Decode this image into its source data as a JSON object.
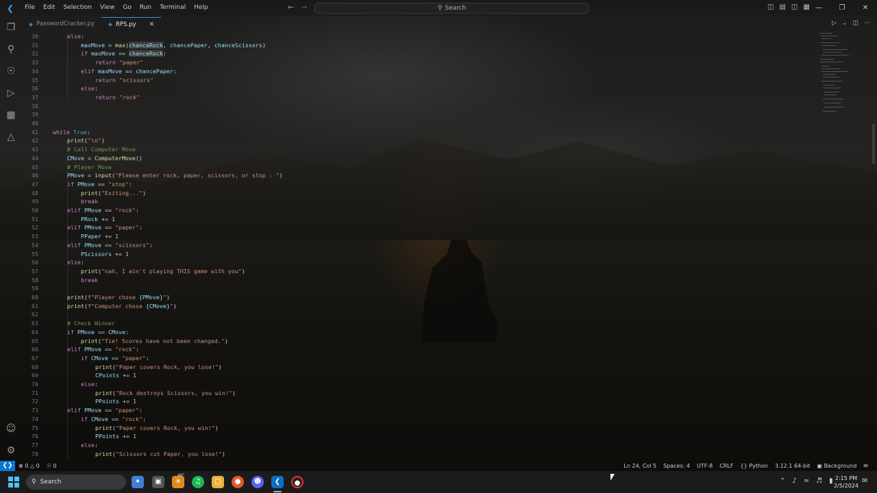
{
  "menu": [
    "File",
    "Edit",
    "Selection",
    "View",
    "Go",
    "Run",
    "Terminal",
    "Help"
  ],
  "search": {
    "label": "Search"
  },
  "tabs": [
    {
      "label": "PasswordCracker.py",
      "active": false
    },
    {
      "label": "RPS.py",
      "active": true
    }
  ],
  "icons": {
    "explorer": "files-icon",
    "search": "search-icon",
    "scm": "source-control-icon",
    "run": "run-debug-icon",
    "extensions": "extensions-icon",
    "testing": "beaker-icon",
    "account": "account-icon",
    "settings": "gear-icon"
  },
  "code": {
    "l30": "30",
    "l31": "31",
    "l32": "32",
    "l33": "33",
    "l34": "34",
    "l35": "35",
    "l36": "36",
    "l37": "37",
    "l38": "38",
    "l39": "39",
    "l40": "40",
    "l41": "41",
    "l42": "42",
    "l43": "43",
    "l44": "44",
    "l45": "45",
    "l46": "46",
    "l47": "47",
    "l48": "48",
    "l49": "49",
    "l50": "50",
    "l51": "51",
    "l52": "52",
    "l53": "53",
    "l54": "54",
    "l55": "55",
    "l56": "56",
    "l57": "57",
    "l58": "58",
    "l59": "59",
    "l60": "60",
    "l61": "61",
    "l62": "62",
    "l63": "63",
    "l64": "64",
    "l65": "65",
    "l66": "66",
    "l67": "67",
    "l68": "68",
    "l69": "69",
    "l70": "70",
    "l71": "71",
    "l72": "72",
    "l73": "73",
    "l74": "74",
    "l75": "75",
    "l76": "76",
    "l77": "77",
    "l78": "78",
    "else": "else",
    "colon": ":",
    "maxMove": "maxMove",
    "eq": " = ",
    "max": "max",
    "chanceRock": "chanceRock",
    "chancePaper": "chancePaper",
    "chanceScissors": "chanceScissors",
    "if": "if",
    "elif": "elif",
    "eqeq": " == ",
    "return": "return",
    "paper": "\"paper\"",
    "scissors": "\"scissors\"",
    "rock": "\"rock\"",
    "while": "while",
    "True": "True",
    "print": "print",
    "newline_str": "\"\\n\"",
    "cm_computer": "# Call Computer Move",
    "CMove": "CMove",
    "ComputerMove": "ComputerMove",
    "cm_player": "# Player Move",
    "PMove": "PMove",
    "input": "input",
    "prompt": "\"Please enter rock, paper, scissors, or stop : \"",
    "stop": "\"stop\"",
    "exiting": "\"Exiting...\"",
    "break": "break",
    "PRock": "PRock",
    "PPaper": "PPaper",
    "PScissors": "PScissors",
    "pluseq": " += ",
    "one": "1",
    "nah": "\"nah, I ain't playing THIS game with you\"",
    "f_player_a": "f\"Player chose ",
    "f_computer_a": "f\"Computer chose ",
    "f_pmove": "{PMove}",
    "f_cmove": "{CMove}",
    "f_end": "\"",
    "cm_winner": "# Check Winner",
    "tie": "\"Tie! Scores have not been changed.\"",
    "paper_covers_lose": "\"Paper covers Rock, you lose!\"",
    "CPoints": "CPoints",
    "rock_destroys_win": "\"Rock destroys Scissors, you win!\"",
    "PPoints": "PPoints",
    "paper_covers_win": "\"Paper covers Rock, you win!\"",
    "scissors_cut_lose": "\"Scissors cut Paper, you lose!\""
  },
  "status": {
    "errors": "0",
    "warnings": "0",
    "ports": "0",
    "position": "Ln 24, Col 5",
    "spaces": "Spaces: 4",
    "encoding": "UTF-8",
    "eol": "CRLF",
    "language": "Python",
    "interpreter": "3.12.1 64-bit",
    "theme": "Background"
  },
  "taskbar": {
    "search_label": "Search",
    "weather": "46°",
    "time": "2:15 PM",
    "date": "2/5/2024"
  }
}
